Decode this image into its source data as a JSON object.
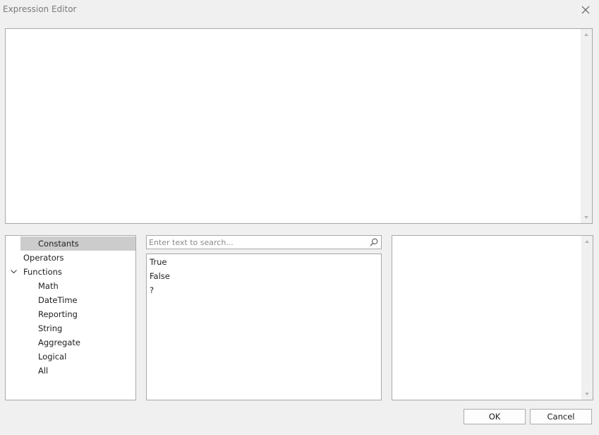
{
  "window": {
    "title": "Expression Editor"
  },
  "editor": {
    "value": ""
  },
  "tree": {
    "items": [
      {
        "label": "Constants",
        "level": 0,
        "selected": true
      },
      {
        "label": "Operators",
        "level": 0
      },
      {
        "label": "Functions",
        "level": 0,
        "expanded": true
      },
      {
        "label": "Math",
        "level": 1
      },
      {
        "label": "DateTime",
        "level": 1
      },
      {
        "label": "Reporting",
        "level": 1
      },
      {
        "label": "String",
        "level": 1
      },
      {
        "label": "Aggregate",
        "level": 1
      },
      {
        "label": "Logical",
        "level": 1
      },
      {
        "label": "All",
        "level": 1
      }
    ]
  },
  "search": {
    "placeholder": "Enter text to search...",
    "value": ""
  },
  "list": {
    "items": [
      "True",
      "False",
      "?"
    ]
  },
  "buttons": {
    "ok": "OK",
    "cancel": "Cancel"
  },
  "icons": {
    "close": "close-icon",
    "search": "search-icon",
    "expander": "chevron-down-icon"
  }
}
